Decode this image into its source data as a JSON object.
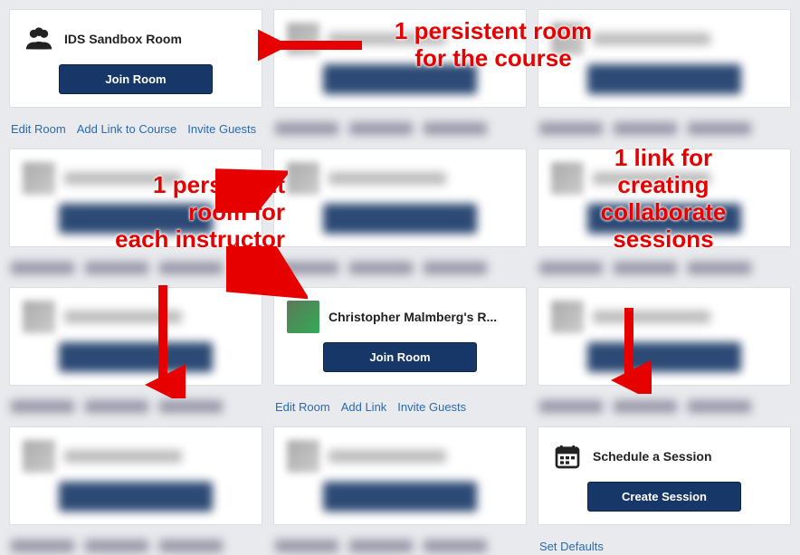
{
  "cards": {
    "course_room": {
      "title": "IDS Sandbox Room",
      "button": "Join Room",
      "actions": [
        "Edit Room",
        "Add Link to Course",
        "Invite Guests"
      ]
    },
    "instructor_room": {
      "title": "Christopher Malmberg's R...",
      "button": "Join Room",
      "actions": [
        "Edit Room",
        "Add Link",
        "Invite Guests"
      ]
    },
    "schedule": {
      "title": "Schedule a Session",
      "button": "Create Session",
      "actions": [
        "Set Defaults"
      ]
    }
  },
  "annotations": {
    "course": "1 persistent room\nfor the course",
    "instructor": "1 persistent\nroom for\neach instructor",
    "sessions": "1 link for\ncreating\ncollaborate\nsessions"
  }
}
